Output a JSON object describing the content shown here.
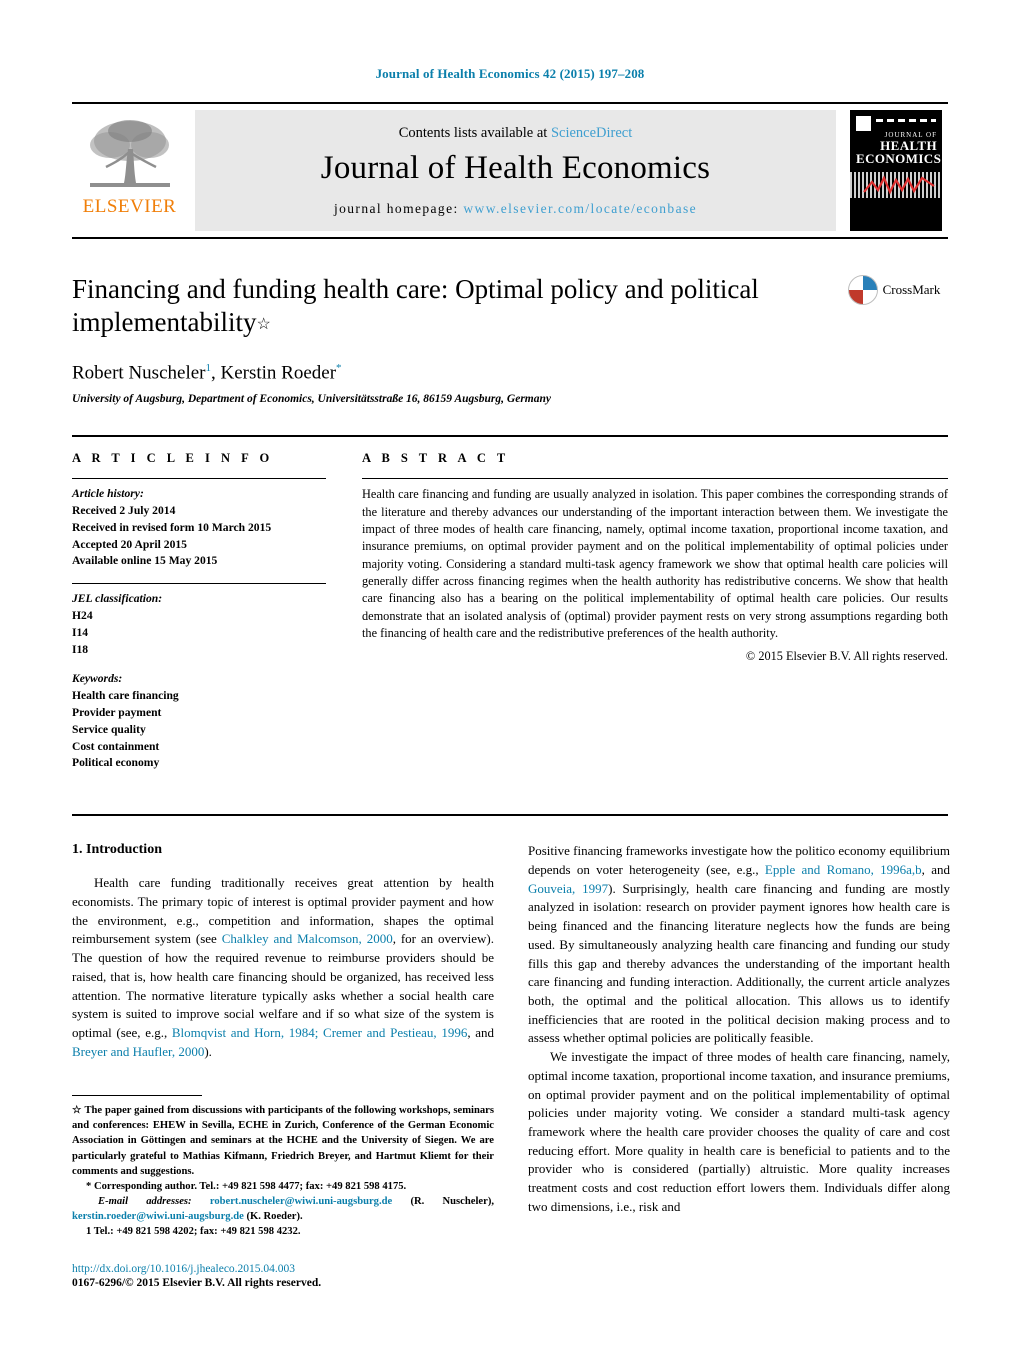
{
  "running_head": "Journal of Health Economics 42 (2015) 197–208",
  "masthead": {
    "contents_prefix": "Contents lists available at ",
    "sciencedirect": "ScienceDirect",
    "journal_title": "Journal of Health Economics",
    "homepage_label": "journal homepage:",
    "homepage_url": "www.elsevier.com/locate/econbase",
    "publisher_word": "ELSEVIER",
    "publisher_color": "#f07f0a",
    "link_color": "#3f9fd0",
    "cover": {
      "line1": "JOURNAL OF",
      "line2": "HEALTH",
      "line3": "ECONOMICS",
      "wave_color": "#e03030"
    }
  },
  "article": {
    "title": "Financing and funding health care: Optimal policy and political implementability",
    "title_footnote_marker": "☆",
    "authors": [
      {
        "name": "Robert Nuscheler",
        "marker": "1"
      },
      {
        "name": "Kerstin Roeder",
        "marker": "*"
      }
    ],
    "authors_line": "Robert Nuscheler",
    "author2_line": ", Kerstin Roeder",
    "affiliation": "University of Augsburg, Department of Economics, Universitätsstraße 16, 86159 Augsburg, Germany",
    "crossmark_label": "CrossMark"
  },
  "article_info": {
    "heading": "A R T I C L E   I N F O",
    "history_label": "Article history:",
    "history": [
      "Received 2 July 2014",
      "Received in revised form 10 March 2015",
      "Accepted 20 April 2015",
      "Available online 15 May 2015"
    ],
    "jel_label": "JEL classification:",
    "jel_codes": [
      "H24",
      "I14",
      "I18"
    ],
    "keywords_label": "Keywords:",
    "keywords": [
      "Health care financing",
      "Provider payment",
      "Service quality",
      "Cost containment",
      "Political economy"
    ]
  },
  "abstract": {
    "heading": "A B S T R A C T",
    "text": "Health care financing and funding are usually analyzed in isolation. This paper combines the corresponding strands of the literature and thereby advances our understanding of the important interaction between them. We investigate the impact of three modes of health care financing, namely, optimal income taxation, proportional income taxation, and insurance premiums, on optimal provider payment and on the political implementability of optimal policies under majority voting. Considering a standard multi-task agency framework we show that optimal health care policies will generally differ across financing regimes when the health authority has redistributive concerns. We show that health care financing also has a bearing on the political implementability of optimal health care policies. Our results demonstrate that an isolated analysis of (optimal) provider payment rests on very strong assumptions regarding both the financing of health care and the redistributive preferences of the health authority.",
    "copyright": "© 2015 Elsevier B.V. All rights reserved."
  },
  "body": {
    "section_number_title": "1.  Introduction",
    "left_para_1": {
      "seg1": "Health care funding traditionally receives great attention by health economists. The primary topic of interest is optimal provider payment and how the environment, e.g., competition and information, shapes the optimal reimbursement system (see ",
      "ref1": "Chalkley and Malcomson, 2000",
      "seg2": ", for an overview). The question of how the required revenue to reimburse providers should be raised, that is, how health care financing should be organized, has received less attention. The normative literature typically asks whether a social health care system is suited to improve social welfare and if so what size of the system is optimal (see, e.g., ",
      "ref2": "Blomqvist and Horn, 1984; Cremer and Pestieau, 1996",
      "seg3": ", and ",
      "ref3": "Breyer and Haufler, 2000",
      "seg4": ")."
    },
    "right_para_1": {
      "seg1": "Positive financing frameworks investigate how the politico economy equilibrium depends on voter heterogeneity (see, e.g., ",
      "ref1": "Epple and Romano, 1996a,b",
      "seg2": ", and ",
      "ref2": "Gouveia, 1997",
      "seg3": "). Surprisingly, health care financing and funding are mostly analyzed in isolation: research on provider payment ignores how health care is being financed and the financing literature neglects how the funds are being used. By simultaneously analyzing health care financing and funding our study fills this gap and thereby advances the understanding of the important health care financing and funding interaction. Additionally, the current article analyzes both, the optimal and the political allocation. This allows us to identify inefficiencies that are rooted in the political decision making process and to assess whether optimal policies are politically feasible."
    },
    "right_para_2": "We investigate the impact of three modes of health care financing, namely, optimal income taxation, proportional income taxation, and insurance premiums, on optimal provider payment and on the political implementability of optimal policies under majority voting. We consider a standard multi-task agency framework where the health care provider chooses the quality of care and cost reducing effort. More quality in health care is beneficial to patients and to the provider who is considered (partially) altruistic. More quality increases treatment costs and cost reduction effort lowers them. Individuals differ along two dimensions, i.e., risk and"
  },
  "footnotes": {
    "star_marker": "☆",
    "star_text": "The paper gained from discussions with participants of the following workshops, seminars and conferences: EHEW in Sevilla, ECHE in Zurich, Conference of the German Economic Association in Göttingen and seminars at the HCHE and the University of Siegen. We are particularly grateful to Mathias Kifmann, Friedrich Breyer, and Hartmut Kliemt for their comments and suggestions.",
    "corresponding_marker": "*",
    "corresponding_text": "Corresponding author. Tel.: +49 821 598 4477; fax: +49 821 598 4175.",
    "email_label": "E-mail addresses:",
    "email1": "robert.nuscheler@wiwi.uni-augsburg.de",
    "email1_who": " (R. Nuscheler),",
    "email2": "kerstin.roeder@wiwi.uni-augsburg.de",
    "email2_who": " (K. Roeder).",
    "fn1_marker": "1",
    "fn1_text": "Tel.: +49 821 598 4202; fax: +49 821 598 4232."
  },
  "footer": {
    "doi": "http://dx.doi.org/10.1016/j.jhealeco.2015.04.003",
    "issn_line": "0167-6296/© 2015 Elsevier B.V. All rights reserved."
  }
}
